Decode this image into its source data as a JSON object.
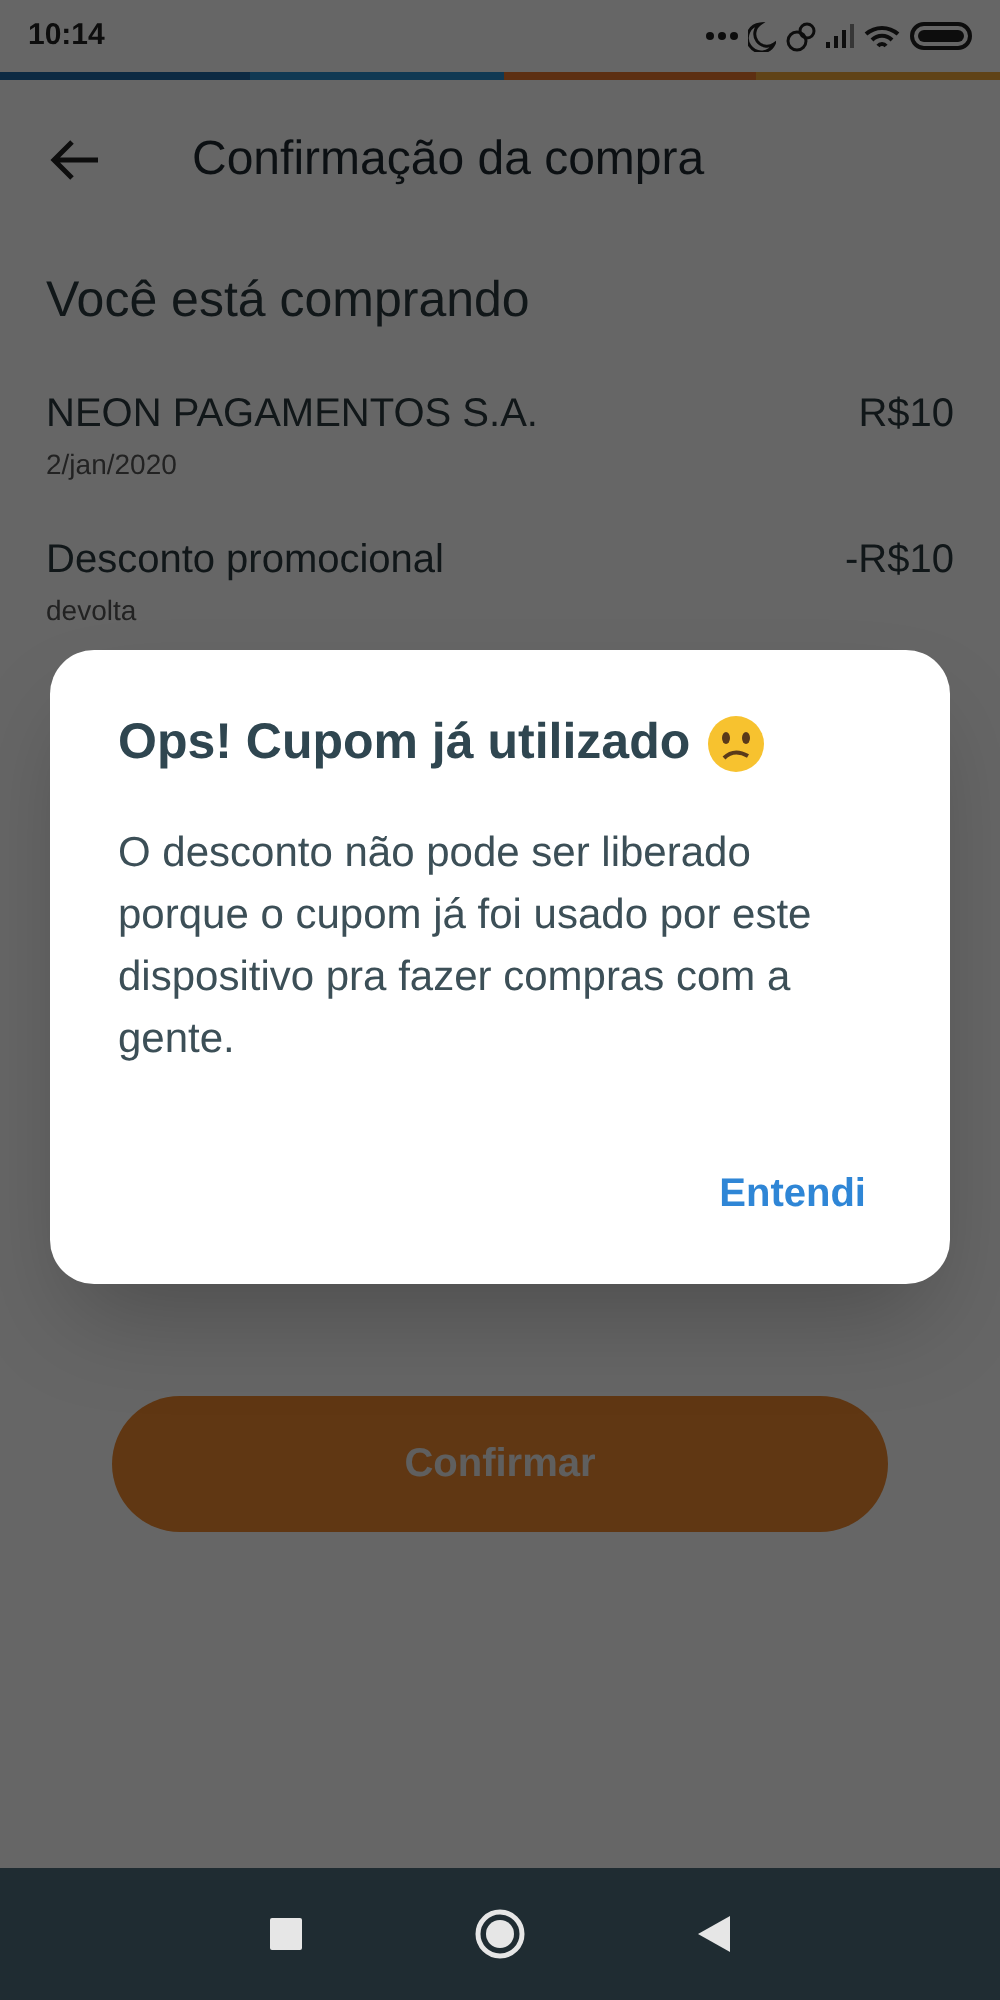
{
  "status_bar": {
    "time": "10:14"
  },
  "header": {
    "title": "Confirmação da compra"
  },
  "section_title": "Você está comprando",
  "items": [
    {
      "name": "NEON PAGAMENTOS S.A.",
      "detail": "2/jan/2020",
      "amount": "R$10"
    },
    {
      "name": "Desconto promocional",
      "detail": "devolta",
      "amount": "-R$10"
    }
  ],
  "confirm_button": {
    "label": "Confirmar"
  },
  "dialog": {
    "title": "Ops! Cupom já utilizado",
    "message": "O desconto não pode ser liberado porque o cupom já foi usado por este dispositivo pra fazer compras com a gente.",
    "action": "Entendi"
  }
}
